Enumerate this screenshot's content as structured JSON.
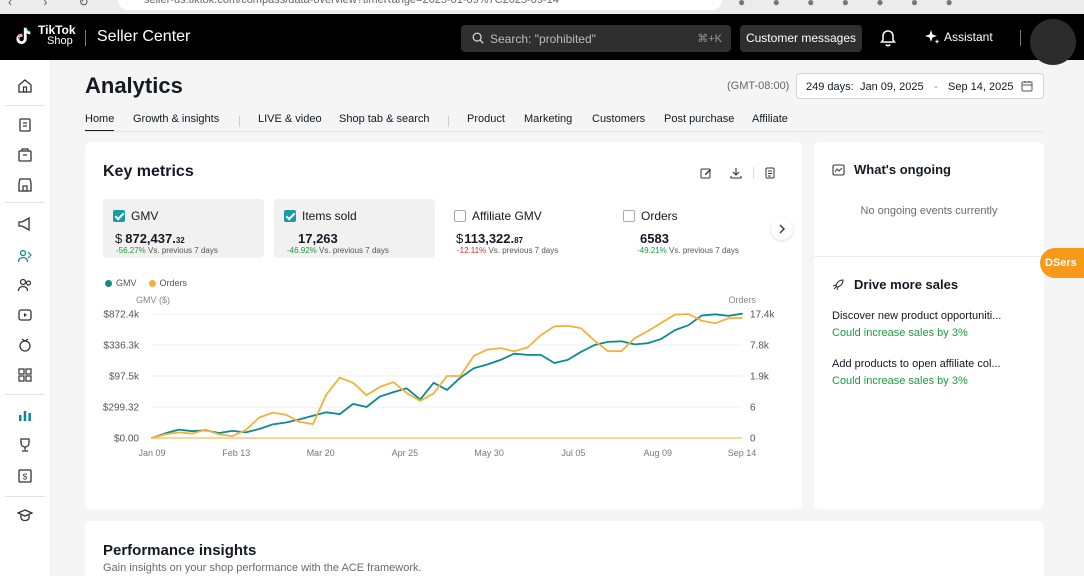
{
  "browser": {
    "url": "seller-us.tiktok.com/compass/data-overview?timeRange=2025-01-09%7C2025-09-14"
  },
  "topbar": {
    "logo_line1": "TikTok",
    "logo_line2": "Shop",
    "title": "Seller Center",
    "search_placeholder": "Search: \"prohibited\"",
    "search_shortcut": "⌘+K",
    "customer_messages": "Customer messages",
    "assistant": "Assistant"
  },
  "page": {
    "title": "Analytics",
    "timezone": "(GMT-08:00)",
    "date_range": {
      "label": "249 days:",
      "start": "Jan 09, 2025",
      "separator": "-",
      "end": "Sep 14, 2025"
    },
    "tabs": [
      {
        "label": "Home",
        "active": true
      },
      {
        "label": "Growth & insights"
      },
      {
        "label": "LIVE & video"
      },
      {
        "label": "Shop tab & search"
      },
      {
        "label": "Product"
      },
      {
        "label": "Marketing"
      },
      {
        "label": "Customers"
      },
      {
        "label": "Post purchase"
      },
      {
        "label": "Affiliate"
      }
    ]
  },
  "key_metrics": {
    "title": "Key metrics",
    "metrics": [
      {
        "label": "GMV",
        "checked": true,
        "currency": "$",
        "value": "872,437.",
        "decimals": "32",
        "change": "-56.27%",
        "compare": "Vs. previous 7 days"
      },
      {
        "label": "Items sold",
        "checked": true,
        "currency": "",
        "value": "17,263",
        "decimals": "",
        "change": "-46.92%",
        "compare": "Vs. previous 7 days"
      },
      {
        "label": "Affiliate GMV",
        "checked": false,
        "currency": "$",
        "value": "113,322.",
        "decimals": "87",
        "change": "-12.11%",
        "compare": "Vs. previous 7 days"
      },
      {
        "label": "Orders",
        "checked": false,
        "currency": "",
        "value": "6583",
        "decimals": "",
        "change": "-49.21%",
        "compare": "Vs. previous 7 days"
      }
    ]
  },
  "colors": {
    "gmv": "#0e8a8f",
    "orders": "#f3b13c",
    "positive": "#1c9c3e",
    "negative": "#d12d2d"
  },
  "chart_data": {
    "type": "line",
    "legend": [
      "GMV",
      "Orders"
    ],
    "y_left_title": "GMV ($)",
    "y_right_title": "Orders",
    "y_left_ticks": [
      "$872.4k",
      "$336.3k",
      "$97.5k",
      "$299.32",
      "$0.00"
    ],
    "y_right_ticks": [
      "17.4k",
      "7.8k",
      "1.9k",
      "6",
      "0"
    ],
    "x_ticks": [
      "Jan 09",
      "Feb 13",
      "Mar 20",
      "Apr 25",
      "May 30",
      "Jul 05",
      "Aug 09",
      "Sep 14"
    ],
    "grid": true,
    "series": [
      {
        "name": "GMV",
        "color": "#0e8a8f",
        "values": [
          0,
          0.15,
          0.27,
          0.22,
          0.25,
          0.16,
          0.23,
          0.18,
          0.29,
          0.44,
          0.5,
          0.6,
          0.72,
          0.83,
          0.77,
          1.1,
          1.0,
          1.34,
          1.48,
          1.6,
          1.24,
          1.78,
          1.55,
          1.95,
          2.25,
          2.37,
          2.52,
          2.72,
          2.68,
          2.68,
          2.42,
          2.52,
          2.78,
          3.0,
          3.1,
          3.12,
          3.02,
          3.06,
          3.2,
          3.48,
          3.64,
          3.95,
          3.99,
          3.94,
          4.01
        ]
      },
      {
        "name": "Orders",
        "color": "#f3b13c",
        "values": [
          0,
          0.12,
          0.18,
          0.14,
          0.27,
          0.12,
          0.06,
          0.26,
          0.66,
          0.82,
          0.75,
          0.52,
          0.45,
          1.4,
          1.95,
          1.78,
          1.38,
          1.65,
          1.8,
          1.45,
          1.2,
          1.44,
          2.0,
          2.0,
          2.65,
          2.85,
          2.9,
          2.8,
          2.92,
          3.32,
          3.6,
          3.62,
          3.54,
          3.14,
          2.8,
          2.8,
          3.22,
          3.45,
          3.72,
          3.98,
          4.0,
          3.78,
          3.7,
          3.86,
          3.87
        ]
      }
    ]
  },
  "whats_ongoing": {
    "title": "What's ongoing",
    "empty": "No ongoing events currently"
  },
  "drive_sales": {
    "title": "Drive more sales",
    "items": [
      {
        "title": "Discover new product opportuniti...",
        "gain": "Could increase sales by 3%"
      },
      {
        "title": "Add products to open affiliate col...",
        "gain": "Could increase sales by 3%"
      }
    ]
  },
  "dsers": "DSers",
  "performance": {
    "title": "Performance insights",
    "subtitle": "Gain insights on your shop performance with the ACE framework."
  }
}
